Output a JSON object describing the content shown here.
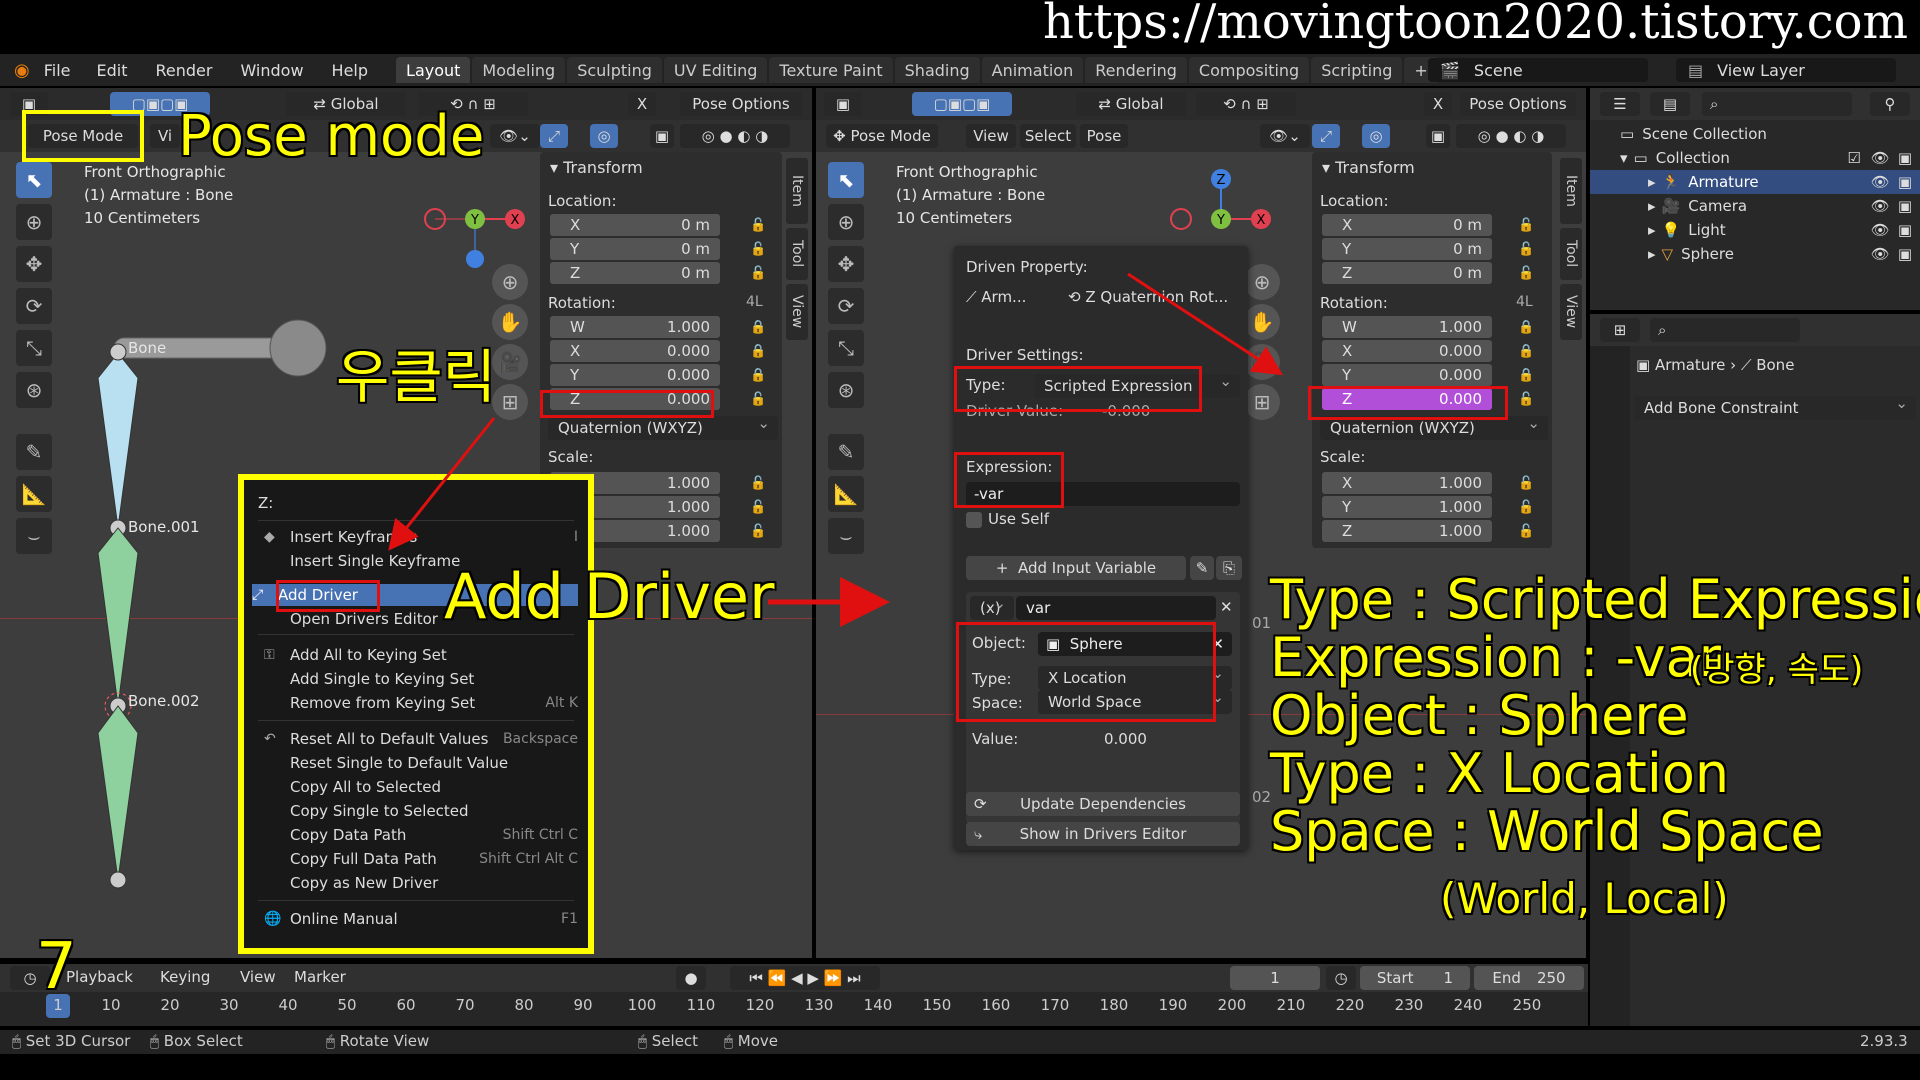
{
  "watermark": "https://movingtoon2020.tistory.com",
  "menubar": {
    "items": [
      "File",
      "Edit",
      "Render",
      "Window",
      "Help"
    ],
    "workspaces": [
      "Layout",
      "Modeling",
      "Sculpting",
      "UV Editing",
      "Texture Paint",
      "Shading",
      "Animation",
      "Rendering",
      "Compositing",
      "Scripting"
    ],
    "active_workspace": "Layout",
    "add_tab": "+",
    "scene": "Scene",
    "view_layer": "View Layer"
  },
  "left_viewport": {
    "header": {
      "orientation": "Global",
      "pose_options": "Pose Options",
      "mode": "Pose Mode",
      "view": "Vi"
    },
    "overlay": {
      "view_name": "Front Orthographic",
      "object": "(1) Armature : Bone",
      "scale": "10 Centimeters"
    },
    "bones": [
      "Bone",
      "Bone.001",
      "Bone.002"
    ],
    "transform": {
      "title": "Transform",
      "location_label": "Location:",
      "location": [
        {
          "axis": "X",
          "value": "0 m"
        },
        {
          "axis": "Y",
          "value": "0 m"
        },
        {
          "axis": "Z",
          "value": "0 m"
        }
      ],
      "rotation_label": "Rotation:",
      "rotation_mode_tag": "4L",
      "rotation": [
        {
          "axis": "W",
          "value": "1.000"
        },
        {
          "axis": "X",
          "value": "0.000"
        },
        {
          "axis": "Y",
          "value": "0.000"
        },
        {
          "axis": "Z",
          "value": "0.000"
        }
      ],
      "rotation_mode": "Quaternion (WXYZ)",
      "scale_label": "Scale:",
      "scale": [
        "1.000",
        "1.000",
        "1.000"
      ]
    },
    "tabs": [
      "Item",
      "Tool",
      "View"
    ],
    "gizmo_axes": [
      "Z",
      "Y",
      "X"
    ]
  },
  "context_menu": {
    "title": "Z:",
    "items": [
      {
        "label": "Insert Keyframes",
        "shortcut": "I",
        "icon": "keyframe-icon"
      },
      {
        "label": "Insert Single Keyframe",
        "shortcut": "",
        "icon": ""
      },
      {
        "label": "Add Driver",
        "shortcut": "",
        "icon": "driver-icon",
        "highlighted": true
      },
      {
        "label": "Open Drivers Editor",
        "shortcut": "",
        "icon": ""
      },
      {
        "label": "Add All to Keying Set",
        "shortcut": "",
        "icon": "keyingset-icon"
      },
      {
        "label": "Add Single to Keying Set",
        "shortcut": "",
        "icon": ""
      },
      {
        "label": "Remove from Keying Set",
        "shortcut": "Alt K",
        "icon": ""
      },
      {
        "label": "Reset All to Default Values",
        "shortcut": "Backspace",
        "icon": "reset-icon"
      },
      {
        "label": "Reset Single to Default Value",
        "shortcut": "",
        "icon": ""
      },
      {
        "label": "Copy All to Selected",
        "shortcut": "",
        "icon": ""
      },
      {
        "label": "Copy Single to Selected",
        "shortcut": "",
        "icon": ""
      },
      {
        "label": "Copy Data Path",
        "shortcut": "Shift Ctrl C",
        "icon": ""
      },
      {
        "label": "Copy Full Data Path",
        "shortcut": "Shift Ctrl Alt C",
        "icon": ""
      },
      {
        "label": "Copy as New Driver",
        "shortcut": "",
        "icon": ""
      },
      {
        "label": "Online Manual",
        "shortcut": "F1",
        "icon": "globe-icon"
      }
    ]
  },
  "right_viewport": {
    "header": {
      "orientation": "Global",
      "pose_options": "Pose Options",
      "mode": "Pose Mode",
      "view": "View",
      "select": "Select",
      "pose": "Pose"
    },
    "overlay": {
      "view_name": "Front Orthographic",
      "object": "(1) Armature : Bone",
      "scale": "10 Centimeters"
    },
    "transform": {
      "title": "Transform",
      "location_label": "Location:",
      "location": [
        {
          "axis": "X",
          "value": "0 m"
        },
        {
          "axis": "Y",
          "value": "0 m"
        },
        {
          "axis": "Z",
          "value": "0 m"
        }
      ],
      "rotation_label": "Rotation:",
      "rotation_mode_tag": "4L",
      "rotation": [
        {
          "axis": "W",
          "value": "1.000"
        },
        {
          "axis": "X",
          "value": "0.000"
        },
        {
          "axis": "Y",
          "value": "0.000"
        },
        {
          "axis": "Z",
          "value": "0.000"
        }
      ],
      "rotation_mode": "Quaternion (WXYZ)",
      "scale_label": "Scale:",
      "scale": [
        {
          "axis": "X",
          "value": "1.000"
        },
        {
          "axis": "Y",
          "value": "1.000"
        },
        {
          "axis": "Z",
          "value": "1.000"
        }
      ]
    },
    "tabs": [
      "Item",
      "Tool",
      "View"
    ],
    "side_numbers": [
      "01",
      "02"
    ]
  },
  "driver_popup": {
    "driven_property_label": "Driven Property:",
    "driven_object": "Arm...",
    "driven_path": "Z Quaternion Rot...",
    "settings_label": "Driver Settings:",
    "type_label": "Type:",
    "type_value": "Scripted Expression",
    "driver_value_label": "Driver Value:",
    "driver_value": "-0.000",
    "expression_label": "Expression:",
    "expression_value": "-var",
    "use_self": "Use Self",
    "add_input_variable": "Add Input Variable",
    "var_type": "(x)",
    "var_name": "var",
    "object_label": "Object:",
    "object_value": "Sphere",
    "var_type_label": "Type:",
    "var_type_value": "X Location",
    "space_label": "Space:",
    "space_value": "World Space",
    "value_label": "Value:",
    "value": "0.000",
    "update_dependencies": "Update Dependencies",
    "show_in_drivers_editor": "Show in Drivers Editor"
  },
  "outliner": {
    "scene_collection": "Scene Collection",
    "collection": "Collection",
    "items": [
      "Armature",
      "Camera",
      "Light",
      "Sphere"
    ]
  },
  "properties": {
    "breadcrumb_object": "Armature",
    "breadcrumb_bone": "Bone",
    "add_bone_constraint": "Add Bone Constraint"
  },
  "timeline": {
    "menus": [
      "Playback",
      "Keying",
      "View",
      "Marker"
    ],
    "current_frame": "1",
    "start_label": "Start",
    "start": "1",
    "end_label": "End",
    "end": "250",
    "ticks": [
      "1",
      "10",
      "20",
      "30",
      "40",
      "50",
      "60",
      "70",
      "80",
      "90",
      "100",
      "110",
      "120",
      "130",
      "140",
      "150",
      "160",
      "170",
      "180",
      "190",
      "200",
      "210",
      "220",
      "230",
      "240",
      "250"
    ]
  },
  "statusbar": {
    "items": [
      "Set 3D Cursor",
      "Box Select",
      "Rotate View",
      "Select",
      "Move"
    ],
    "version": "2.93.3"
  },
  "annotations": {
    "pose_mode": "Pose mode",
    "right_click": "우클릭",
    "add_driver": "Add Driver",
    "step_number": "7",
    "summary": [
      "Type : Scripted Expression",
      "Expression : -var",
      "Object : Sphere",
      "Type : X Location",
      "Space : World Space"
    ],
    "expression_note": "(방향, 속도)",
    "space_note": "(World, Local)"
  },
  "colors": {
    "accent": "#4772b3",
    "highlight_field": "#b14fd8",
    "annotation_yellow": "#ffff00",
    "annotation_red": "#e01010",
    "bone_green": "#8fd19e"
  }
}
